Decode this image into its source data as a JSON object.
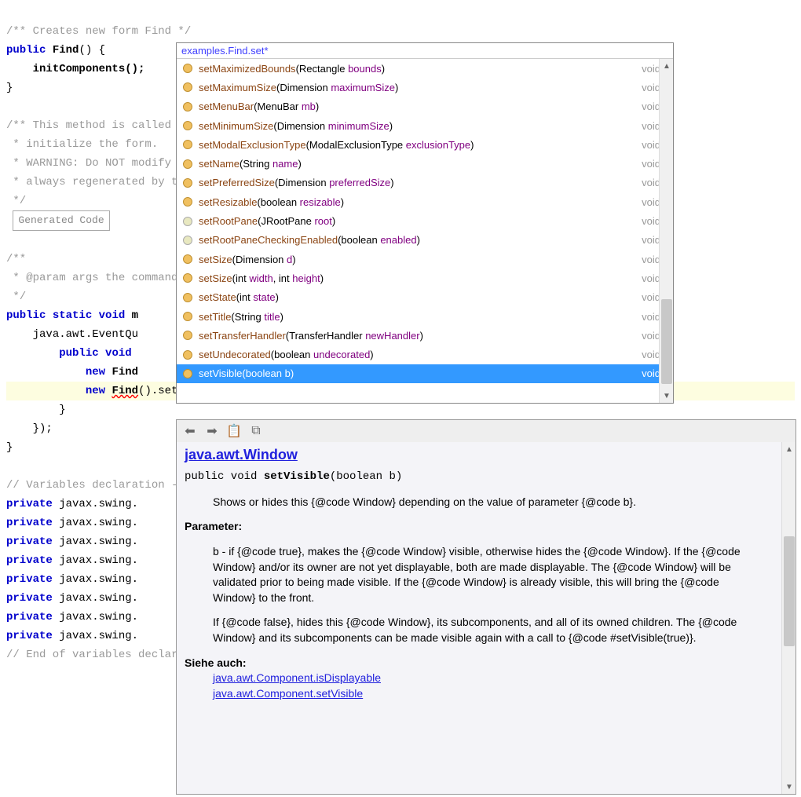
{
  "code": {
    "l0": "/** Creates new form Find */",
    "l1_kw1": "public",
    "l1_id": "Find",
    "l1_rest": "() {",
    "l2": "initComponents();",
    "l3": "}",
    "l4": "/** This method is called from within the ...",
    "l5": " * initialize the form.",
    "l6": " * WARNING: Do NOT modify this code. The ...",
    "l7": " * always regenerated by the Form Editor.",
    "l8": " */",
    "l9": "Generated Code",
    "l10": "/**",
    "l11": " * @param args the command line args",
    "l12": " */",
    "l13_kw1": "public",
    "l13_kw2": "static",
    "l13_kw3": "void",
    "l13_id": "m",
    "l14": "java.awt.EventQu",
    "l15_kw1": "public",
    "l15_kw2": "void",
    "l16_kw": "new",
    "l16_id": "Find",
    "l17_kw": "new",
    "l17_id": "Find",
    "l17_call": "().",
    "l17_typed": "set",
    "l18": "}",
    "l19": "});",
    "l20": "}",
    "l21": "// Variables declaration - do not modify",
    "l22_kw": "private",
    "l22_rest": " javax.swing.",
    "l23": "// End of variables declaration"
  },
  "popup": {
    "header": "examples.Find.set*",
    "items": [
      {
        "icon": "circle",
        "name": "setMaximizedBounds",
        "sig": "(Rectangle bounds)",
        "ptype": "Rectangle",
        "pname": "bounds",
        "ret": "void"
      },
      {
        "icon": "circle",
        "name": "setMaximumSize",
        "sig": "(Dimension maximumSize)",
        "ptype": "Dimension",
        "pname": "maximumSize",
        "ret": "void"
      },
      {
        "icon": "circle",
        "name": "setMenuBar",
        "sig": "(MenuBar mb)",
        "ptype": "MenuBar",
        "pname": "mb",
        "ret": "void"
      },
      {
        "icon": "circle",
        "name": "setMinimumSize",
        "sig": "(Dimension minimumSize)",
        "ptype": "Dimension",
        "pname": "minimumSize",
        "ret": "void"
      },
      {
        "icon": "circle",
        "name": "setModalExclusionType",
        "sig": "(ModalExclusionType exclusionType)",
        "ptype": "ModalExclusionType",
        "pname": "exclusionType",
        "ret": "void"
      },
      {
        "icon": "circle",
        "name": "setName",
        "sig": "(String name)",
        "ptype": "String",
        "pname": "name",
        "ret": "void"
      },
      {
        "icon": "circle",
        "name": "setPreferredSize",
        "sig": "(Dimension preferredSize)",
        "ptype": "Dimension",
        "pname": "preferredSize",
        "ret": "void"
      },
      {
        "icon": "circle",
        "name": "setResizable",
        "sig": "(boolean resizable)",
        "ptype": "boolean",
        "pname": "resizable",
        "ret": "void"
      },
      {
        "icon": "key",
        "name": "setRootPane",
        "sig": "(JRootPane root)",
        "ptype": "JRootPane",
        "pname": "root",
        "ret": "void"
      },
      {
        "icon": "key",
        "name": "setRootPaneCheckingEnabled",
        "sig": "(boolean enabled)",
        "ptype": "boolean",
        "pname": "enabled",
        "ret": "void"
      },
      {
        "icon": "circle",
        "name": "setSize",
        "sig": "(Dimension d)",
        "ptype": "Dimension",
        "pname": "d",
        "ret": "void"
      },
      {
        "icon": "circle",
        "name": "setSize",
        "sig": "(int width, int height)",
        "ptype": "int",
        "pname": "width, int height",
        "ret": "void",
        "multi": true
      },
      {
        "icon": "circle",
        "name": "setState",
        "sig": "(int state)",
        "ptype": "int",
        "pname": "state",
        "ret": "void"
      },
      {
        "icon": "circle",
        "name": "setTitle",
        "sig": "(String title)",
        "ptype": "String",
        "pname": "title",
        "ret": "void"
      },
      {
        "icon": "circle",
        "name": "setTransferHandler",
        "sig": "(TransferHandler newHandler)",
        "ptype": "TransferHandler",
        "pname": "newHandler",
        "ret": "void"
      },
      {
        "icon": "circle",
        "name": "setUndecorated",
        "sig": "(boolean undecorated)",
        "ptype": "boolean",
        "pname": "undecorated",
        "ret": "void"
      },
      {
        "icon": "circle",
        "name": "setVisible",
        "sig": "(boolean b)",
        "ptype": "boolean",
        "pname": "b",
        "ret": "void",
        "selected": true
      }
    ]
  },
  "doc": {
    "class_link": "java.awt.Window",
    "signature_pre": "public void ",
    "signature_name": "setVisible",
    "signature_post": "(boolean b)",
    "body1": "Shows or hides this {@code Window} depending on the value of parameter {@code b}.",
    "param_heading": "Parameter:",
    "body2": "b - if {@code true}, makes the {@code Window} visible, otherwise hides the {@code Window}. If the {@code Window} and/or its owner are not yet displayable, both are made displayable. The {@code Window} will be validated prior to being made visible. If the {@code Window} is already visible, this will bring the {@code Window} to the front.",
    "body3": "If {@code false}, hides this {@code Window}, its subcomponents, and all of its owned children. The {@code Window} and its subcomponents can be made visible again with a call to {@code #setVisible(true)}.",
    "see_heading": "Siehe auch:",
    "see1": "java.awt.Component.isDisplayable",
    "see2": "java.awt.Component.setVisible"
  }
}
